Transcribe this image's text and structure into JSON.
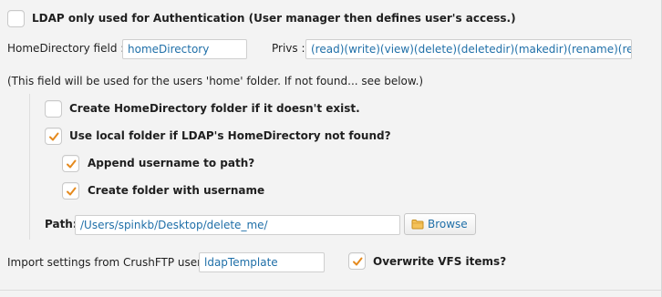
{
  "ldap_only": {
    "label": "LDAP only used for Authentication (User manager then defines user's access.)",
    "checked": false
  },
  "home_directory": {
    "label": "HomeDirectory field :",
    "value": "homeDirectory"
  },
  "privs": {
    "label": "Privs :",
    "value": "(read)(write)(view)(delete)(deletedir)(makedir)(rename)(resume)"
  },
  "help_text": "(This field will be used for the users 'home' folder. If not found... see below.)",
  "create_home_folder": {
    "label": "Create HomeDirectory folder if it doesn't exist.",
    "checked": false
  },
  "use_local_folder": {
    "label": "Use local folder if LDAP's HomeDirectory not found?",
    "checked": true
  },
  "append_username": {
    "label": "Append username to path?",
    "checked": true
  },
  "create_folder_username": {
    "label": "Create folder with username",
    "checked": true
  },
  "path": {
    "label": "Path:",
    "value": "/Users/spinkb/Desktop/delete_me/",
    "browse_label": "Browse"
  },
  "import_settings": {
    "label": "Import settings from CrushFTP user :",
    "value": "ldapTemplate"
  },
  "overwrite_vfs": {
    "label": "Overwrite VFS items?",
    "checked": true
  },
  "colors": {
    "checkmark": "#e58a1e",
    "field_text": "#1f6fa8"
  }
}
